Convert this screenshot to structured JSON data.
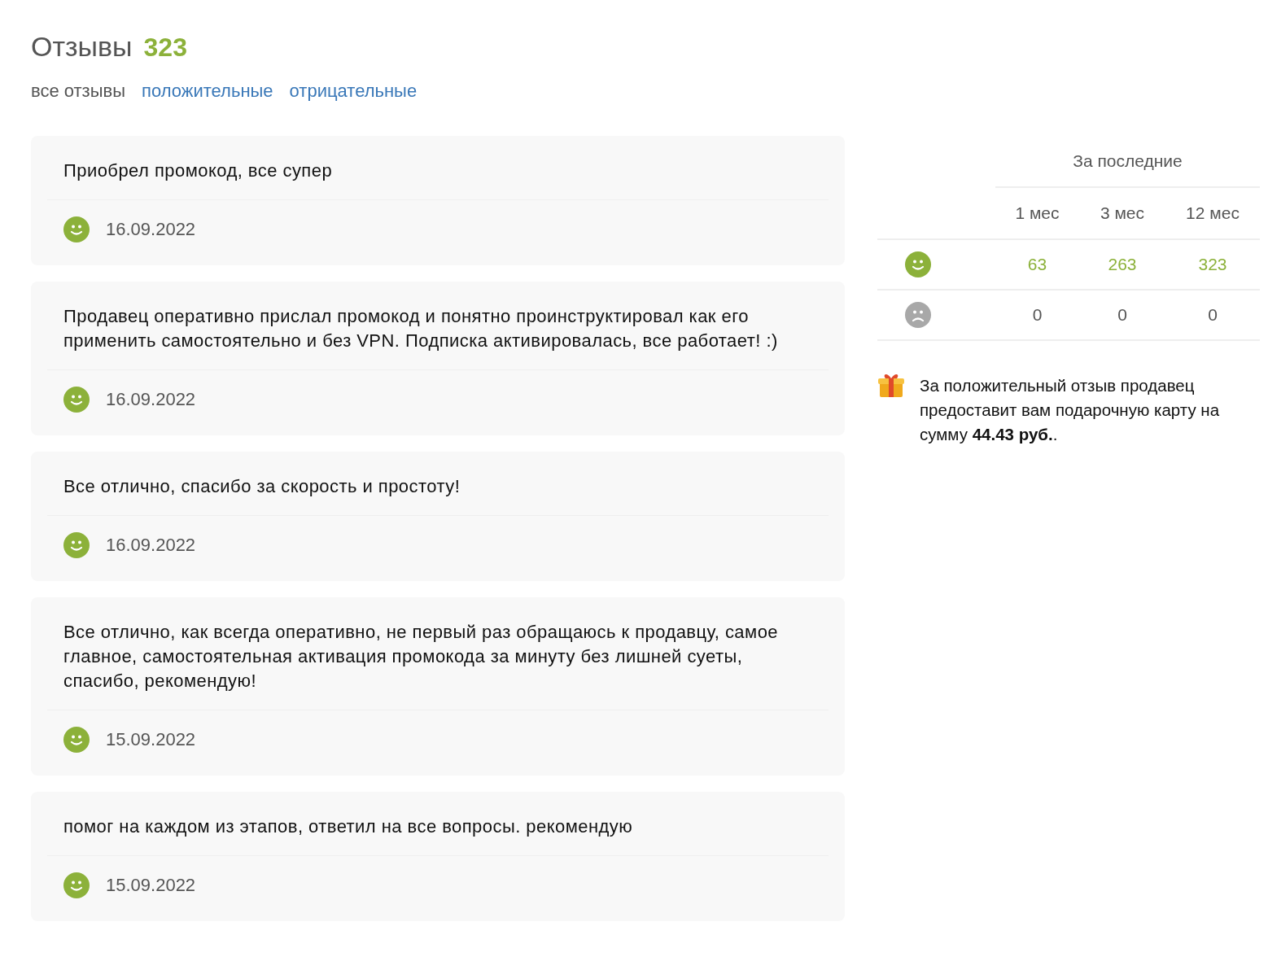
{
  "header": {
    "title": "Отзывы",
    "count": "323"
  },
  "filters": [
    {
      "label": "все отзывы",
      "selected": true
    },
    {
      "label": "положительные",
      "selected": false
    },
    {
      "label": "отрицательные",
      "selected": false
    }
  ],
  "reviews": [
    {
      "text": "Приобрел промокод, все супер",
      "kind": "positive",
      "date": "16.09.2022"
    },
    {
      "text": "Продавец оперативно прислал промокод и понятно проинструктировал как его применить самостоятельно и без VPN. Подписка активировалась, все работает! :)",
      "kind": "positive",
      "date": "16.09.2022"
    },
    {
      "text": "Все отлично, спасибо за скорость и простоту!",
      "kind": "positive",
      "date": "16.09.2022"
    },
    {
      "text": "Все отлично, как всегда оперативно, не первый раз обращаюсь к продавцу, самое главное, самостоятельная активация промокода за минуту без лишней суеты, спасибо, рекомендую!",
      "kind": "positive",
      "date": "15.09.2022"
    },
    {
      "text": "помог на каждом из этапов, ответил на все вопросы. рекомендую",
      "kind": "positive",
      "date": "15.09.2022"
    }
  ],
  "stats": {
    "heading": "За последние",
    "columns": [
      "1 мес",
      "3 мес",
      "12 мес"
    ],
    "rows": [
      {
        "kind": "positive",
        "values": [
          "63",
          "263",
          "323"
        ]
      },
      {
        "kind": "negative",
        "values": [
          "0",
          "0",
          "0"
        ]
      }
    ]
  },
  "bonus": {
    "text": "За положительный отзыв продавец предоставит вам подарочную карту на сумму **44.43 руб.**."
  }
}
